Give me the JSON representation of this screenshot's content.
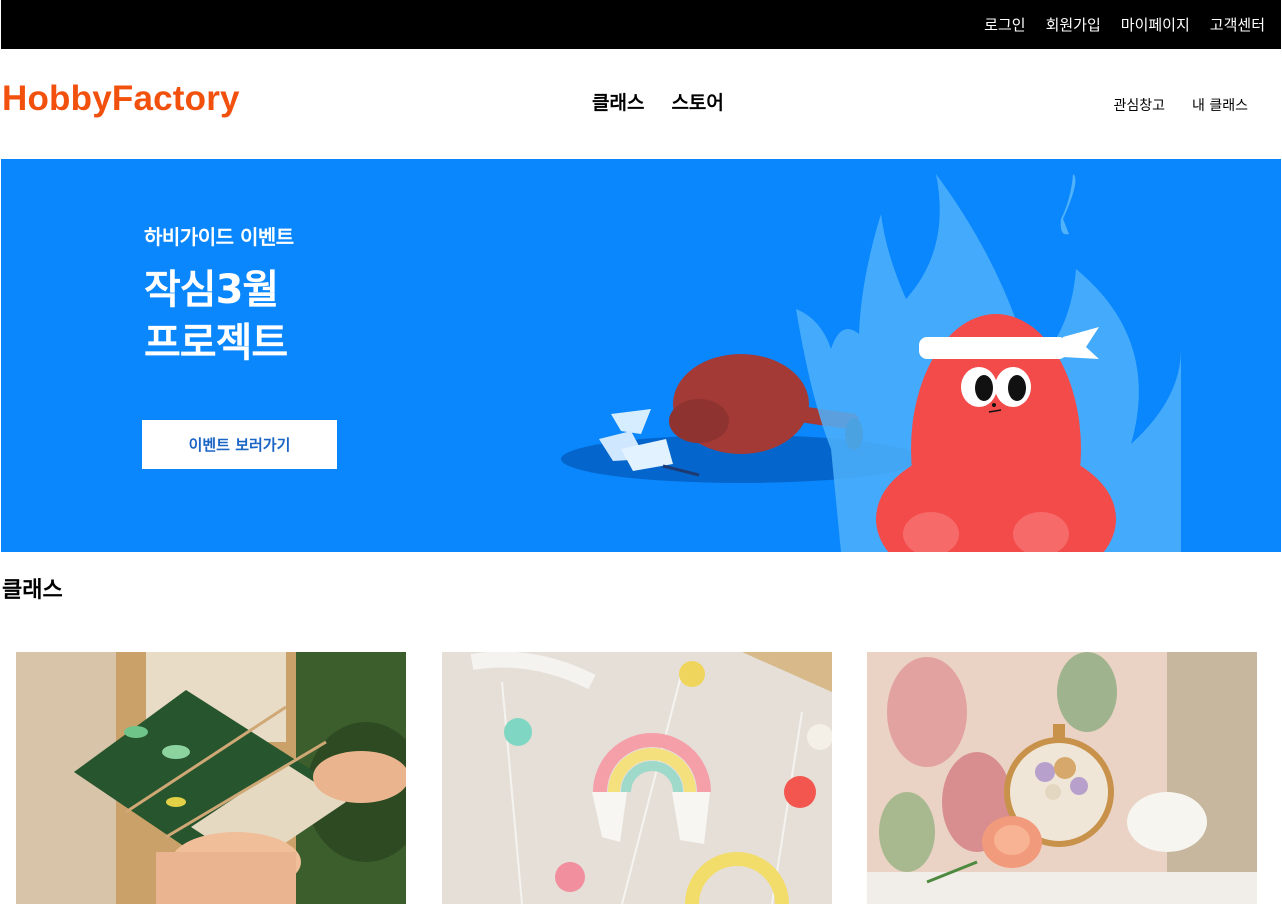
{
  "top_bar": {
    "links": [
      "로그인",
      "회원가입",
      "마이페이지",
      "고객센터"
    ]
  },
  "header": {
    "logo": "HobbyFactory",
    "main_nav": [
      "클래스",
      "스토어"
    ],
    "user_nav": [
      "관심창고",
      "내 클래스"
    ]
  },
  "banner": {
    "kicker": "하비가이드 이벤트",
    "title_line1": "작심3월",
    "title_line2": "프로젝트",
    "button_label": "이벤트 보러가기"
  },
  "section": {
    "title": "클래스"
  },
  "cards": [
    {
      "image": "book-wrapping-craft-photo"
    },
    {
      "image": "rainbow-macrame-wall-hanging-photo"
    },
    {
      "image": "embroidery-hoop-flowers-photo"
    }
  ],
  "colors": {
    "top_bar_bg": "#000000",
    "logo": "#f2500d",
    "banner_bg": "#0a87fc",
    "mascot": "#f34a4a",
    "flame": "#4fb2fb"
  }
}
